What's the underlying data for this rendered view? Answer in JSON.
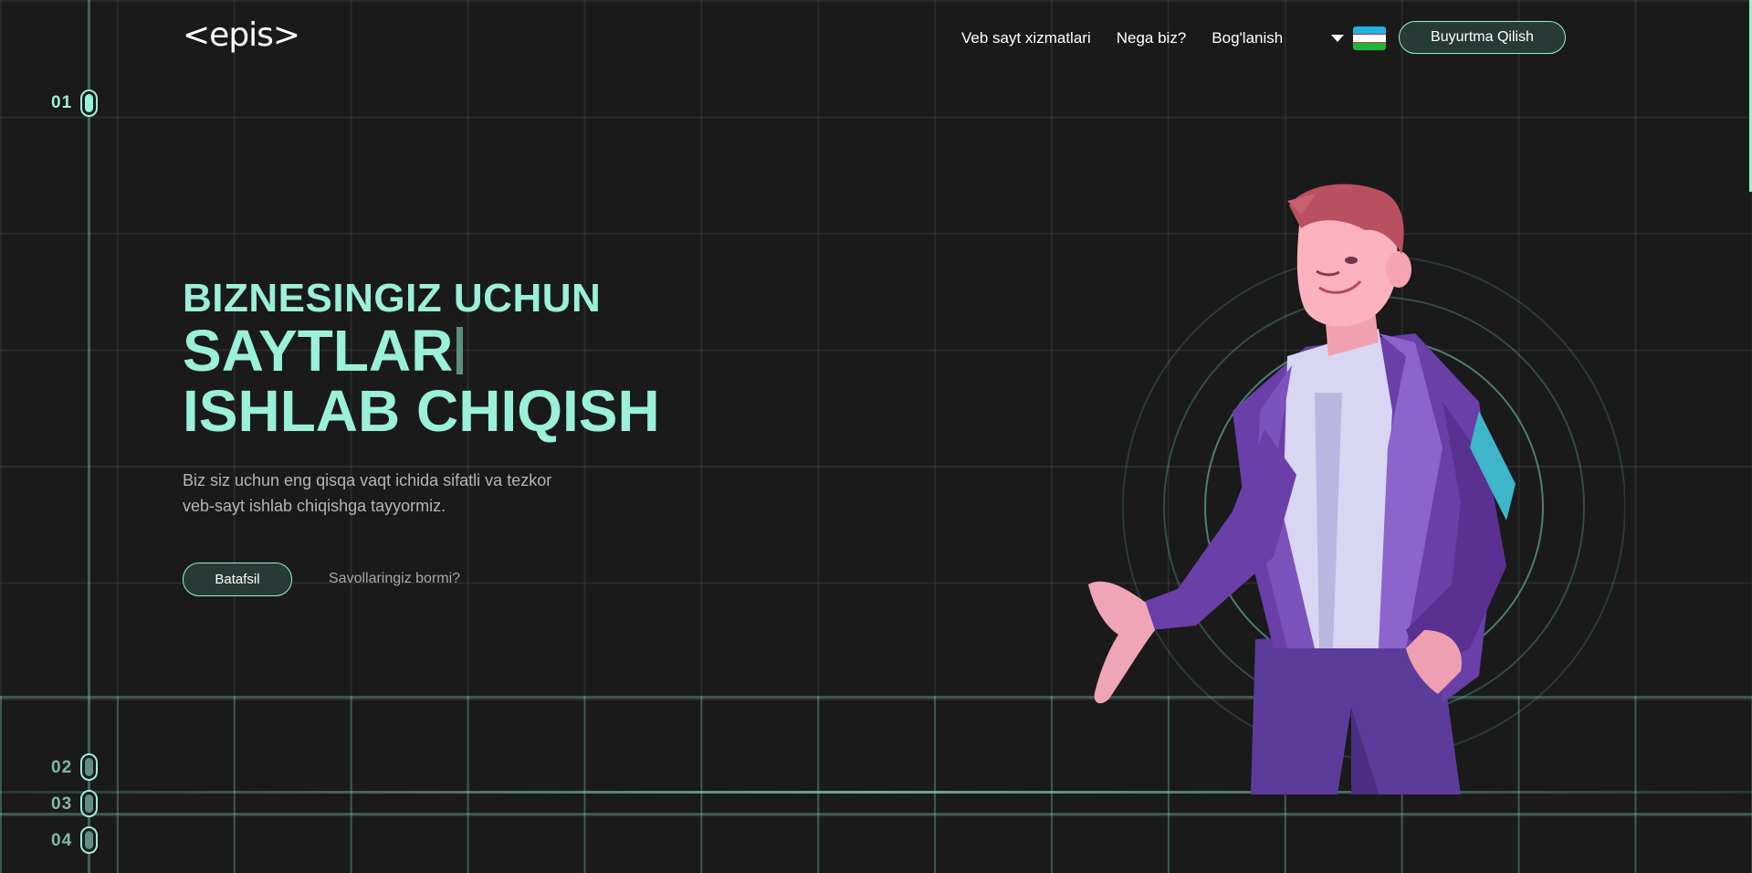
{
  "header": {
    "logo_text": "<epis>",
    "nav": [
      {
        "label": "Veb sayt xizmatlari"
      },
      {
        "label": "Nega biz?"
      },
      {
        "label": "Bog'lanish"
      }
    ],
    "language_flag": "uzbekistan-flag-icon",
    "order_button": "Buyurtma Qilish"
  },
  "side_nav": {
    "sections": [
      {
        "label": "01",
        "active": true
      },
      {
        "label": "02",
        "active": false
      },
      {
        "label": "03",
        "active": false
      },
      {
        "label": "04",
        "active": false
      }
    ]
  },
  "hero": {
    "subtitle": "BIZNESINGIZ UCHUN",
    "title_line1": "SAYTLAR",
    "title_line2": "ISHLAB CHIQISH",
    "description": "Biz siz uchun eng qisqa vaqt ichida sifatli va tezkor veb-sayt ishlab chiqishga tayyormiz.",
    "primary_button": "Batafsil",
    "secondary_link": "Savollaringiz bormi?"
  },
  "colors": {
    "background": "#1a1a1a",
    "accent": "#9af0d8",
    "button_fill": "#263b36"
  }
}
